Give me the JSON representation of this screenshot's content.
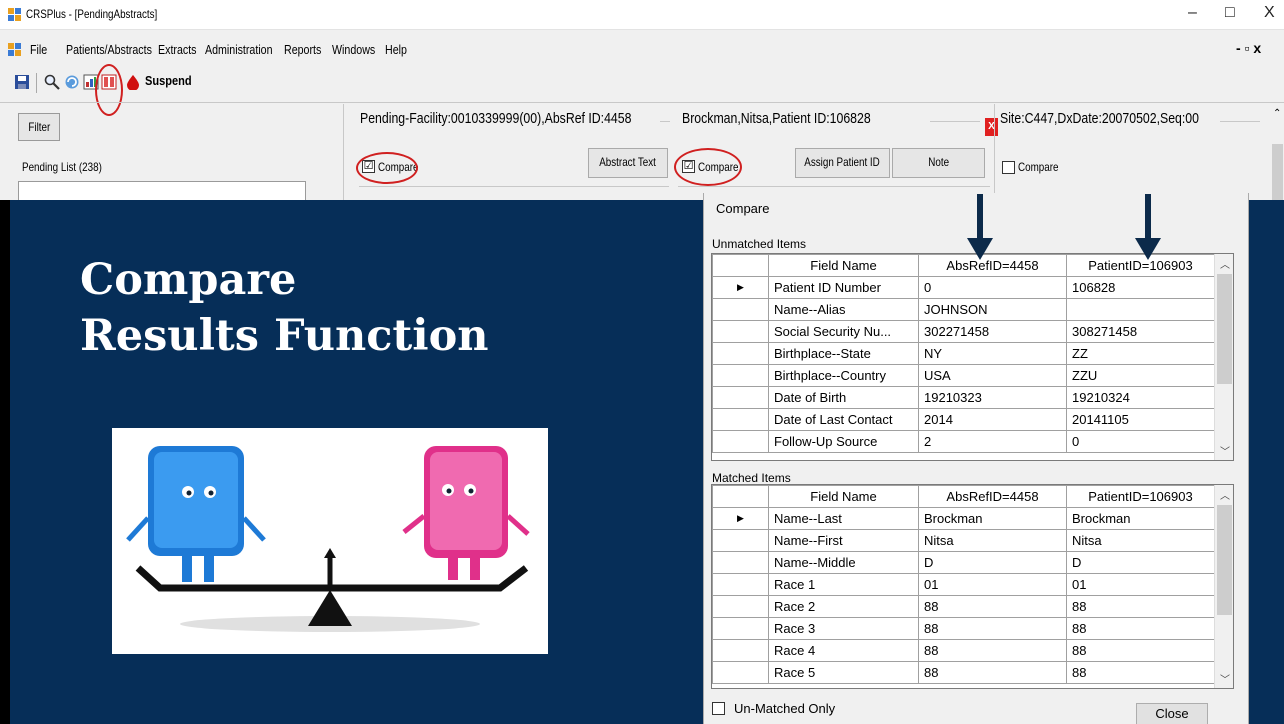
{
  "window": {
    "title": "CRSPlus - [PendingAbstracts]",
    "minimize": "–",
    "restore": "□",
    "close": "X"
  },
  "menubar": {
    "items": [
      "File",
      "Patients/Abstracts",
      "Extracts",
      "Administration",
      "Reports",
      "Windows",
      "Help"
    ],
    "mdi_controls": "- ▫ x"
  },
  "toolbar": {
    "suspend_label": "Suspend"
  },
  "left_panel": {
    "filter_label": "Filter",
    "pending_list_label": "Pending List (238)"
  },
  "panels": [
    {
      "header": "Pending-Facility:0010339999(00),AbsRef ID:4458",
      "compare_label": "Compare",
      "compare_checked": "☑",
      "button": "Abstract Text"
    },
    {
      "header": "Brockman,Nitsa,Patient ID:106828",
      "compare_label": "Compare",
      "compare_checked": "☑",
      "button1": "Assign Patient ID",
      "button2": "Note",
      "close": "X"
    },
    {
      "header": "Site:C447,DxDate:20070502,Seq:00",
      "compare_label": "Compare"
    }
  ],
  "slide": {
    "title_line1": "Compare",
    "title_line2": "Results Function"
  },
  "dialog": {
    "title": "Compare",
    "unmatched_label": "Unmatched Items",
    "matched_label": "Matched Items",
    "columns": [
      "Field Name",
      "AbsRefID=4458",
      "PatientID=106903"
    ],
    "row_marker": "▶",
    "unmatched_rows": [
      [
        "Patient ID Number",
        "0",
        "106828"
      ],
      [
        "Name--Alias",
        "JOHNSON",
        ""
      ],
      [
        "Social Security Nu...",
        "302271458",
        "308271458"
      ],
      [
        "Birthplace--State",
        "NY",
        "ZZ"
      ],
      [
        "Birthplace--Country",
        "USA",
        "ZZU"
      ],
      [
        "Date of Birth",
        "19210323",
        "19210324"
      ],
      [
        "Date of Last Contact",
        "2014",
        "20141105"
      ],
      [
        "Follow-Up Source",
        "2",
        "0"
      ]
    ],
    "matched_rows": [
      [
        "Name--Last",
        "Brockman",
        "Brockman"
      ],
      [
        "Name--First",
        "Nitsa",
        "Nitsa"
      ],
      [
        "Name--Middle",
        "D",
        "D"
      ],
      [
        "Race 1",
        "01",
        "01"
      ],
      [
        "Race 2",
        "88",
        "88"
      ],
      [
        "Race 3",
        "88",
        "88"
      ],
      [
        "Race 4",
        "88",
        "88"
      ],
      [
        "Race 5",
        "88",
        "88"
      ]
    ],
    "unmatched_only_label": "Un-Matched Only",
    "close_label": "Close"
  },
  "colors": {
    "slide_bg": "#062e58",
    "highlight": "#d02020",
    "arrow": "#0c2a4a"
  }
}
